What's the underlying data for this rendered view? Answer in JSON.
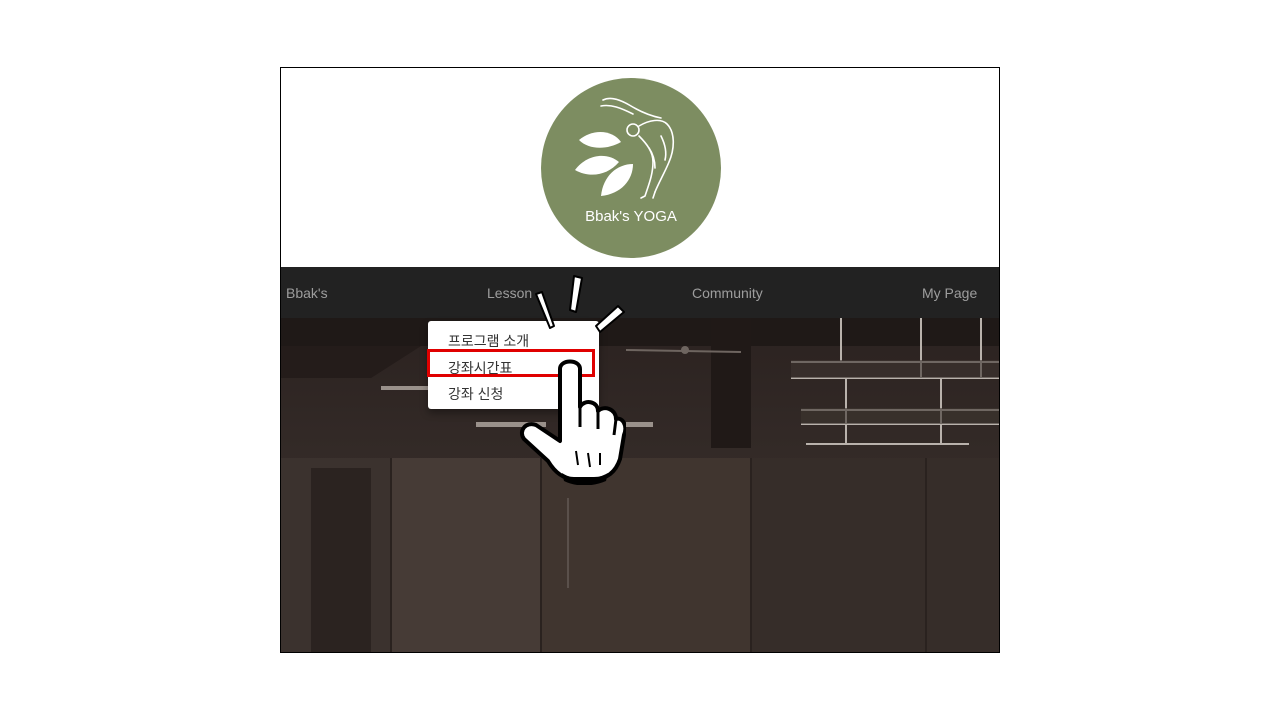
{
  "logo": {
    "text": "Bbak's YOGA",
    "color": "#7d8d61"
  },
  "nav": {
    "items": [
      {
        "label": "Bbak's"
      },
      {
        "label": "Lesson"
      },
      {
        "label": "Community"
      },
      {
        "label": "My Page"
      }
    ],
    "background": "#222222",
    "text_color": "#9d9d9d"
  },
  "dropdown": {
    "items": [
      {
        "label": "프로그램 소개"
      },
      {
        "label": "강좌시간표",
        "highlighted": true
      },
      {
        "label": "강좌 신청"
      }
    ]
  },
  "annotations": {
    "highlight_color": "#e00000",
    "pointer_icon": "pointing-hand-icon",
    "emphasis_icon": "emphasis-burst-icon"
  }
}
